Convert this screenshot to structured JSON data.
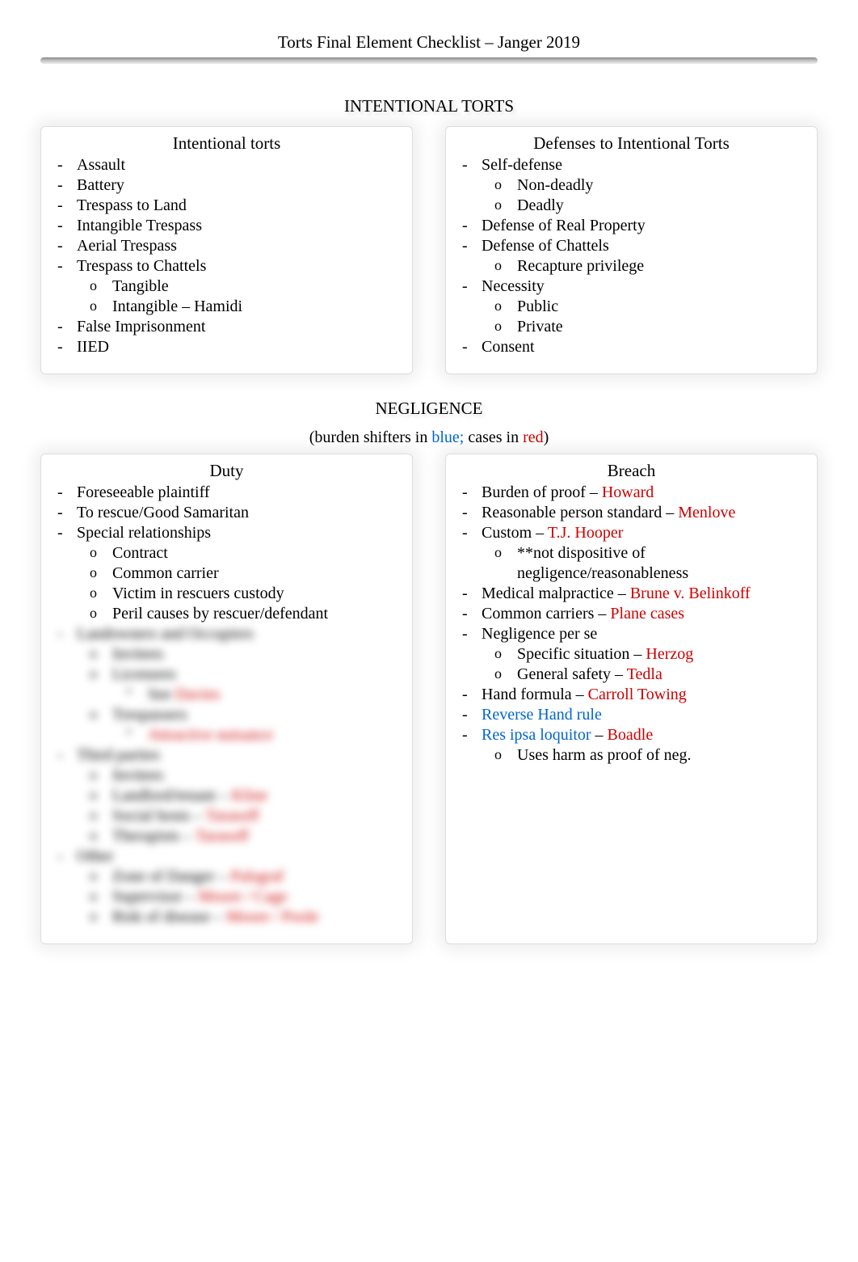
{
  "pageTitle": "Torts Final Element Checklist – Janger 2019",
  "section1": {
    "heading": "INTENTIONAL TORTS",
    "left": {
      "title": "Intentional torts",
      "items": [
        {
          "text": "Assault"
        },
        {
          "text": "Battery"
        },
        {
          "text": "Trespass to Land"
        },
        {
          "text": "Intangible Trespass"
        },
        {
          "text": "Aerial Trespass"
        },
        {
          "text": "Trespass to Chattels",
          "sub": [
            {
              "text": "Tangible"
            },
            {
              "text": "Intangible – Hamidi"
            }
          ]
        },
        {
          "text": "False Imprisonment"
        },
        {
          "text": "IIED"
        }
      ]
    },
    "right": {
      "title": "Defenses to Intentional Torts",
      "items": [
        {
          "text": "Self-defense",
          "sub": [
            {
              "text": "Non-deadly"
            },
            {
              "text": "Deadly"
            }
          ]
        },
        {
          "text": "Defense of Real Property"
        },
        {
          "text": "Defense of Chattels",
          "sub": [
            {
              "text": "Recapture privilege"
            }
          ]
        },
        {
          "text": "Necessity",
          "sub": [
            {
              "text": "Public"
            },
            {
              "text": "Private"
            }
          ]
        },
        {
          "text": "Consent"
        }
      ]
    }
  },
  "section2": {
    "heading": "NEGLIGENCE",
    "caption_pre": "(burden shifters in ",
    "caption_blue": "blue;",
    "caption_mid": " cases in ",
    "caption_red": "red",
    "caption_post": ")",
    "left": {
      "title": "Duty",
      "items": [
        {
          "text": "Foreseeable plaintiff"
        },
        {
          "text": "To rescue/Good Samaritan"
        },
        {
          "text": "Special relationships",
          "sub": [
            {
              "text": "Contract"
            },
            {
              "text": "Common carrier"
            },
            {
              "text": "Victim in rescuers custody"
            },
            {
              "text": "Peril causes by rescuer/defendant"
            }
          ]
        }
      ],
      "blurred": [
        {
          "text": "Landowners and Occupiers",
          "sub": [
            {
              "text": "Invitees"
            },
            {
              "text": "Licensees",
              "sub2": [
                {
                  "pre": "See ",
                  "red": "Davies"
                }
              ]
            },
            {
              "text": "Trespassers",
              "sub2": [
                {
                  "pre": "",
                  "red": "Attractive nuisance"
                }
              ]
            }
          ]
        },
        {
          "text": "Third parties",
          "sub": [
            {
              "text": "Invitees"
            },
            {
              "pre": "Landlord/tenant – ",
              "red": "Kline"
            },
            {
              "pre": "Social hosts – ",
              "red": "Tarasoff"
            },
            {
              "pre": "Therapists – ",
              "red": "Tarasoff"
            }
          ]
        },
        {
          "text": "Other",
          "sub": [
            {
              "pre": "Zone of Danger – ",
              "red": "Palsgraf"
            },
            {
              "pre": "Supervisor – ",
              "red": "Moore / Cage"
            },
            {
              "pre": "Risk of disease – ",
              "red": "Moore / Poole"
            }
          ]
        }
      ]
    },
    "right": {
      "title": "Breach",
      "items": [
        {
          "pre": "Burden of proof – ",
          "red": "Howard"
        },
        {
          "pre": "Reasonable person standard – ",
          "red": "Menlove"
        },
        {
          "pre": "Custom – ",
          "red": "T.J. Hooper",
          "sub": [
            {
              "text": "**not dispositive of negligence/reasonableness"
            }
          ]
        },
        {
          "pre": "Medical malpractice – ",
          "red": "Brune v. Belinkoff"
        },
        {
          "pre": "Common carriers – ",
          "red": "Plane cases"
        },
        {
          "text": "Negligence per se",
          "sub": [
            {
              "pre": "Specific situation – ",
              "red": "Herzog"
            },
            {
              "pre": "General safety – ",
              "red": "Tedla"
            }
          ]
        },
        {
          "pre": "Hand formula – ",
          "red": "Carroll Towing"
        },
        {
          "blue": "Reverse Hand rule"
        },
        {
          "blue": "Res ipsa loquitor",
          "mid": " – ",
          "red": "Boadle",
          "sub": [
            {
              "text": "Uses harm as proof of neg."
            }
          ]
        }
      ]
    }
  }
}
